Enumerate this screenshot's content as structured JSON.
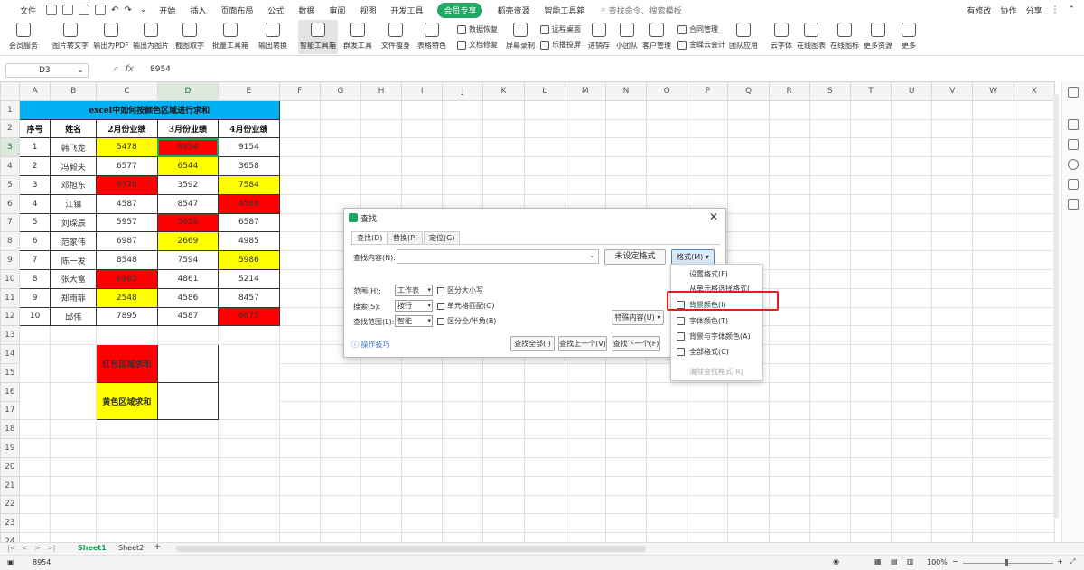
{
  "menubar": {
    "file": "文件",
    "tabs": [
      "开始",
      "插入",
      "页面布局",
      "公式",
      "数据",
      "审阅",
      "视图",
      "开发工具"
    ],
    "member": "会员专享",
    "tabs2": [
      "稻壳资源",
      "智能工具箱"
    ],
    "search": "查找命令、搜索模板",
    "right": [
      "有修改",
      "协作",
      "分享"
    ]
  },
  "ribbon": {
    "buttons": [
      "会员服务",
      "图片转文字",
      "输出为PDF",
      "输出为图片",
      "截图取字",
      "批量工具箱",
      "输出转换",
      "智能工具箱",
      "群发工具",
      "文件瘦身",
      "表格特色"
    ],
    "small": [
      "数据恢复",
      "文档修复",
      "屏幕录制",
      "远程桌面",
      "乐播投屏",
      "进销存",
      "小团队",
      "客户管理",
      "合同管理",
      "金蝶云会计",
      "团队应用",
      "云字体",
      "在线图表",
      "在线图标",
      "更多资源",
      "更多"
    ]
  },
  "formula": {
    "cell_ref": "D3",
    "value": "8954"
  },
  "columns": [
    "A",
    "B",
    "C",
    "D",
    "E",
    "F",
    "G",
    "H",
    "I",
    "J",
    "K",
    "L",
    "M",
    "N",
    "O",
    "P",
    "Q",
    "R",
    "S",
    "T",
    "U",
    "V",
    "W",
    "X"
  ],
  "rows": [
    "1",
    "2",
    "3",
    "4",
    "5",
    "6",
    "7",
    "8",
    "9",
    "10",
    "11",
    "12",
    "13",
    "14",
    "15",
    "16",
    "17",
    "18",
    "19",
    "20",
    "21",
    "22",
    "23",
    "24"
  ],
  "table": {
    "title": "excel中如何按颜色区域进行求和",
    "headers": [
      "序号",
      "姓名",
      "2月份业绩",
      "3月份业绩",
      "4月份业绩"
    ],
    "rows": [
      [
        "1",
        "韩飞龙",
        "5478",
        "8954",
        "9154"
      ],
      [
        "2",
        "冯毅夫",
        "6577",
        "6544",
        "3658"
      ],
      [
        "3",
        "邓旭东",
        "9578",
        "3592",
        "7584"
      ],
      [
        "4",
        "江镇",
        "4587",
        "8547",
        "4589"
      ],
      [
        "5",
        "刘琛辰",
        "5957",
        "3658",
        "6587"
      ],
      [
        "6",
        "范家伟",
        "6987",
        "2669",
        "4985"
      ],
      [
        "7",
        "陈一发",
        "8548",
        "7594",
        "5986"
      ],
      [
        "8",
        "张大富",
        "6985",
        "4861",
        "5214"
      ],
      [
        "9",
        "郑雨菲",
        "2548",
        "4586",
        "8457"
      ],
      [
        "10",
        "邱伟",
        "7895",
        "4587",
        "6875"
      ]
    ],
    "colors": {
      "yellow": "#ffff00",
      "red": "#ff0000",
      "title_bg": "#00b0f0"
    }
  },
  "sums": {
    "red_label": "红色区域求和",
    "yellow_label": "黄色区域求和"
  },
  "dialog": {
    "title": "查找",
    "tabs": [
      "查找(D)",
      "替换(P)",
      "定位(G)"
    ],
    "find_label": "查找内容(N):",
    "no_format": "未设定格式",
    "format_btn": "格式(M)",
    "scope_label": "范围(H):",
    "scope_value": "工作表",
    "search_label": "搜索(S):",
    "search_value": "按行",
    "lookin_label": "查找范围(L):",
    "lookin_value": "智能",
    "check_case": "区分大小写",
    "check_cell": "单元格匹配(O)",
    "check_width": "区分全/半角(B)",
    "special": "特殊内容(U)",
    "tips": "操作技巧",
    "find_all": "查找全部(I)",
    "find_prev": "查找上一个(V)",
    "find_next": "查找下一个(F)"
  },
  "format_menu": {
    "items": [
      "设置格式(F)",
      "从单元格选择格式(",
      "背景颜色(I)",
      "字体颜色(T)",
      "背景与字体颜色(A)",
      "全部格式(C)",
      "清除查找格式(R)"
    ]
  },
  "sheets": {
    "active": "Sheet1",
    "other": "Sheet2"
  },
  "status": {
    "value": "8954",
    "zoom": "100%"
  }
}
